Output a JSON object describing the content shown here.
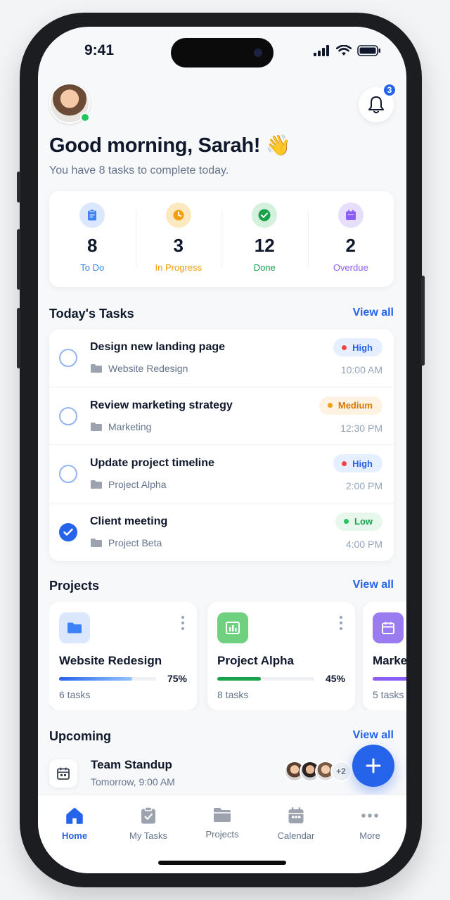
{
  "status_bar": {
    "time": "9:41"
  },
  "header": {
    "greeting": "Good morning, Sarah! 👋",
    "subtitle": "You have 8 tasks to complete today.",
    "notification_count": "3"
  },
  "stats": [
    {
      "value": "8",
      "label": "To Do",
      "color": "#3b82f6",
      "bg": "#dbe7fd",
      "icon": "clipboard-icon"
    },
    {
      "value": "3",
      "label": "In Progress",
      "color": "#f59e0b",
      "bg": "#fde9c0",
      "icon": "clock-icon"
    },
    {
      "value": "12",
      "label": "Done",
      "color": "#16a34a",
      "bg": "#d3f1dc",
      "icon": "check-circle-icon"
    },
    {
      "value": "2",
      "label": "Overdue",
      "color": "#8b5cf6",
      "bg": "#e7defc",
      "icon": "calendar-icon"
    }
  ],
  "todays_tasks": {
    "title": "Today's Tasks",
    "view_all": "View all",
    "items": [
      {
        "title": "Design new landing page",
        "project": "Website Redesign",
        "priority": "High",
        "time": "10:00 AM",
        "done": false
      },
      {
        "title": "Review marketing strategy",
        "project": "Marketing",
        "priority": "Medium",
        "time": "12:30 PM",
        "done": false
      },
      {
        "title": "Update project timeline",
        "project": "Project Alpha",
        "priority": "High",
        "time": "2:00 PM",
        "done": false
      },
      {
        "title": "Client meeting",
        "project": "Project Beta",
        "priority": "Low",
        "time": "4:00 PM",
        "done": true
      }
    ]
  },
  "priority_colors": {
    "High": {
      "text": "#2563eb",
      "bg": "#e6efff",
      "dot": "#ef4444"
    },
    "Medium": {
      "text": "#d97706",
      "bg": "#fef3e2",
      "dot": "#f59e0b"
    },
    "Low": {
      "text": "#16a34a",
      "bg": "#e7f7ec",
      "dot": "#22c55e"
    }
  },
  "projects": {
    "title": "Projects",
    "view_all": "View all",
    "items": [
      {
        "name": "Website Redesign",
        "percent": "75%",
        "progress": 0.75,
        "tasks": "6 tasks",
        "icon": "folder-icon",
        "color": "#3b82f6",
        "bg": "#dbe7fd"
      },
      {
        "name": "Project Alpha",
        "percent": "45%",
        "progress": 0.45,
        "tasks": "8 tasks",
        "icon": "chart-icon",
        "color": "#22c55e",
        "bg": "#6fd07f"
      },
      {
        "name": "Marke",
        "percent": "",
        "progress": 0.6,
        "tasks": "5 tasks",
        "icon": "calendar-icon",
        "color": "#8b5cf6",
        "bg": "#9a7cf0"
      }
    ]
  },
  "upcoming": {
    "title": "Upcoming",
    "view_all": "View all",
    "item": {
      "title": "Team Standup",
      "time": "Tomorrow, 9:00 AM",
      "extra_attendees": "+2"
    }
  },
  "tab_bar": [
    {
      "label": "Home",
      "icon": "home-icon",
      "active": true
    },
    {
      "label": "My Tasks",
      "icon": "clipboard-check-icon",
      "active": false
    },
    {
      "label": "Projects",
      "icon": "folder-icon",
      "active": false
    },
    {
      "label": "Calendar",
      "icon": "calendar-icon",
      "active": false
    },
    {
      "label": "More",
      "icon": "more-dots-icon",
      "active": false
    }
  ]
}
